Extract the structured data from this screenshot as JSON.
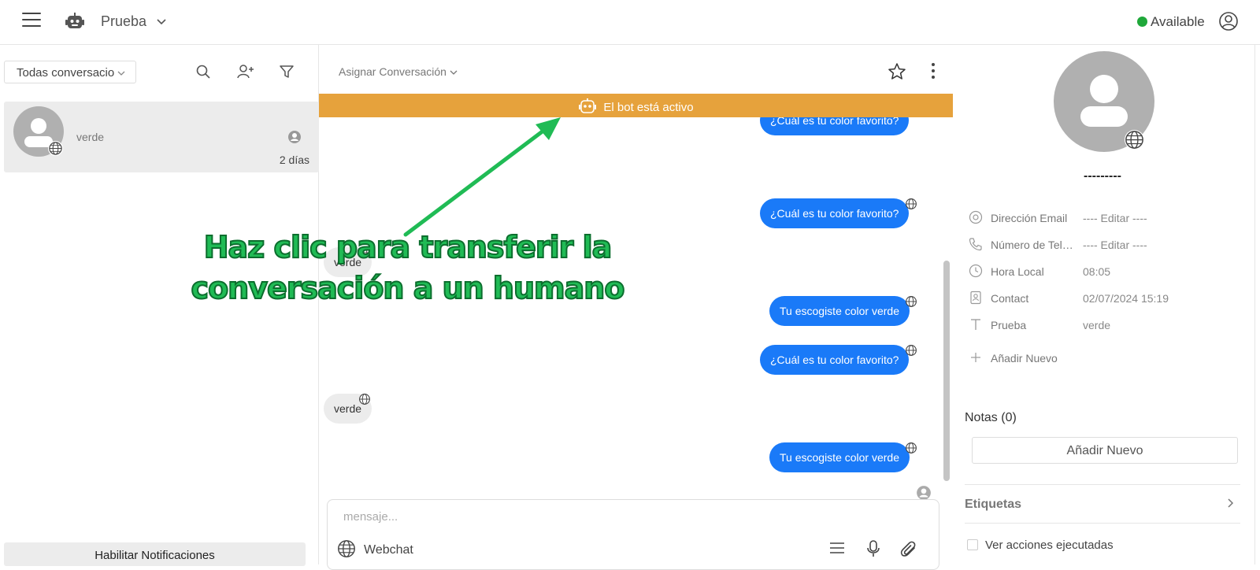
{
  "topbar": {
    "app_name": "Prueba",
    "status": "Available",
    "status_color": "#1fa83a"
  },
  "left": {
    "filter": "Todas conversacio",
    "conversations": [
      {
        "name": "verde",
        "time": "2 días"
      }
    ],
    "notifications_button": "Habilitar Notificaciones"
  },
  "center": {
    "assign_label": "Asignar Conversación",
    "bot_banner": "El bot está activo",
    "banner_color": "#e6a23c",
    "messages": [
      {
        "side": "out",
        "text": "¿Cuál es tu color favorito?"
      },
      {
        "side": "out",
        "text": "¿Cuál es tu color favorito?"
      },
      {
        "side": "in",
        "text": "verde"
      },
      {
        "side": "out",
        "text": "Tu escogiste color verde"
      },
      {
        "side": "out",
        "text": "¿Cuál es tu color favorito?"
      },
      {
        "side": "in",
        "text": "verde"
      },
      {
        "side": "out",
        "text": "Tu escogiste color verde"
      }
    ],
    "composer_placeholder": "mensaje...",
    "channel": "Webchat"
  },
  "right": {
    "contact_name": "---------",
    "attributes": [
      {
        "icon": "at-icon",
        "label": "Dirección Email",
        "value": "---- Editar ----"
      },
      {
        "icon": "phone-icon",
        "label": "Número de Teléfono",
        "value": "---- Editar ----"
      },
      {
        "icon": "clock-icon",
        "label": "Hora Local",
        "value": "08:05"
      },
      {
        "icon": "contact-card-icon",
        "label": "Contact",
        "value": "02/07/2024 15:19"
      },
      {
        "icon": "text-icon",
        "label": "Prueba",
        "value": "verde"
      }
    ],
    "add_attribute": "Añadir Nuevo",
    "notes_title": "Notas (0)",
    "notes_button": "Añadir Nuevo",
    "tags_title": "Etiquetas",
    "actions_checkbox": "Ver acciones ejecutadas"
  },
  "annotation": {
    "line1": "Haz clic para transferir la",
    "line2": "conversación a un humano",
    "color": "#20bb55"
  }
}
